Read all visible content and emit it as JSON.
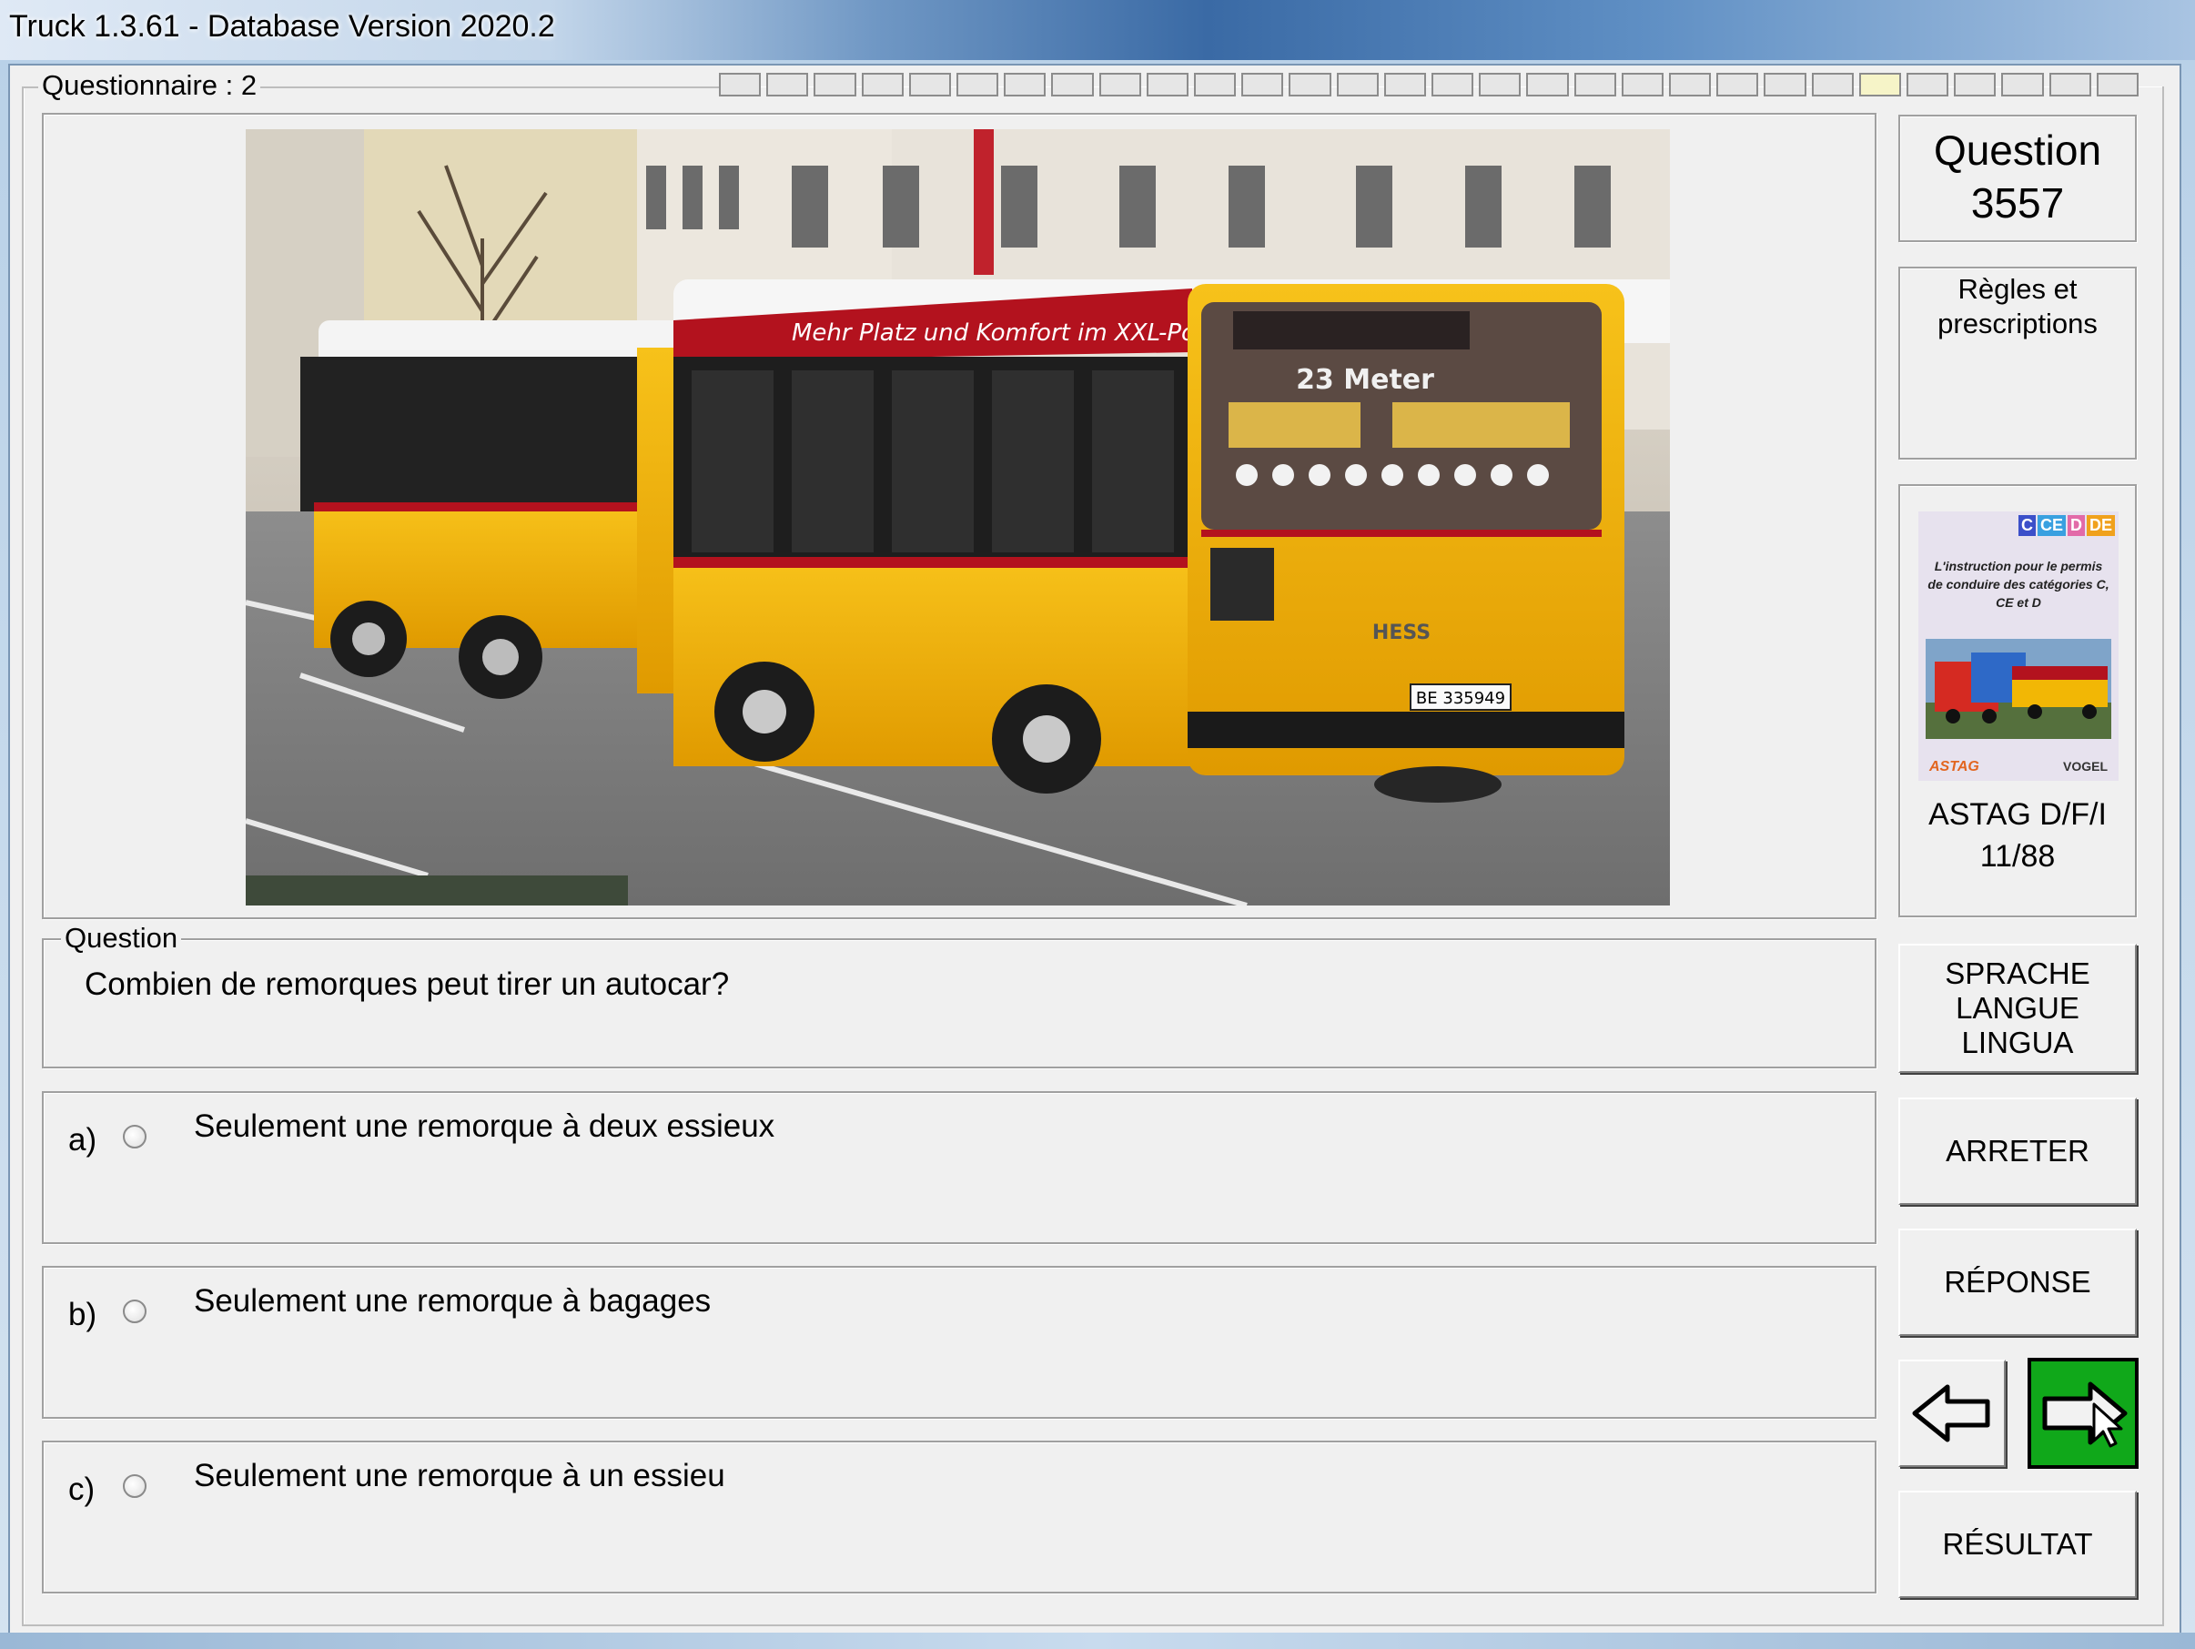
{
  "window": {
    "title": "Truck 1.3.61 - Database Version 2020.2"
  },
  "questionnaire": {
    "label": "Questionnaire : 2",
    "progress_total": 30,
    "progress_current": 25
  },
  "question_box": {
    "legend": "Question",
    "text": "Combien de remorques peut tirer un autocar?"
  },
  "answers": [
    {
      "letter": "a)",
      "text": "Seulement une remorque à deux essieux",
      "selected": false
    },
    {
      "letter": "b)",
      "text": "Seulement une remorque à bagages",
      "selected": false
    },
    {
      "letter": "c)",
      "text": "Seulement une remorque à un essieu",
      "selected": false
    }
  ],
  "sidebar": {
    "question_label": "Question",
    "question_number": "3557",
    "rules_line1": "Règles et",
    "rules_line2": "prescriptions",
    "book_caption_line1": "ASTAG D/F/I",
    "book_caption_line2": "11/88",
    "book_tags": [
      "C",
      "CE",
      "D",
      "DE"
    ],
    "book_text": "L'instruction pour le permis de conduire des catégories C, CE et D",
    "book_logo_left": "ASTAG",
    "book_logo_right": "VOGEL",
    "language_line1": "SPRACHE",
    "language_line2": "LANGUE",
    "language_line3": "LINGUA",
    "stop_label": "ARRETER",
    "answer_label": "RÉPONSE",
    "result_label": "RÉSULTAT"
  },
  "photo": {
    "bus_banner": "Mehr Platz und Komfort im XXL-Postauto",
    "bus_display": "23 Meter",
    "bus_brand": "HESS",
    "plate": "BE 335949"
  },
  "colors": {
    "postbus_yellow": "#f2b705",
    "postbus_red": "#b3121e",
    "next_button_green": "#10a81a"
  }
}
